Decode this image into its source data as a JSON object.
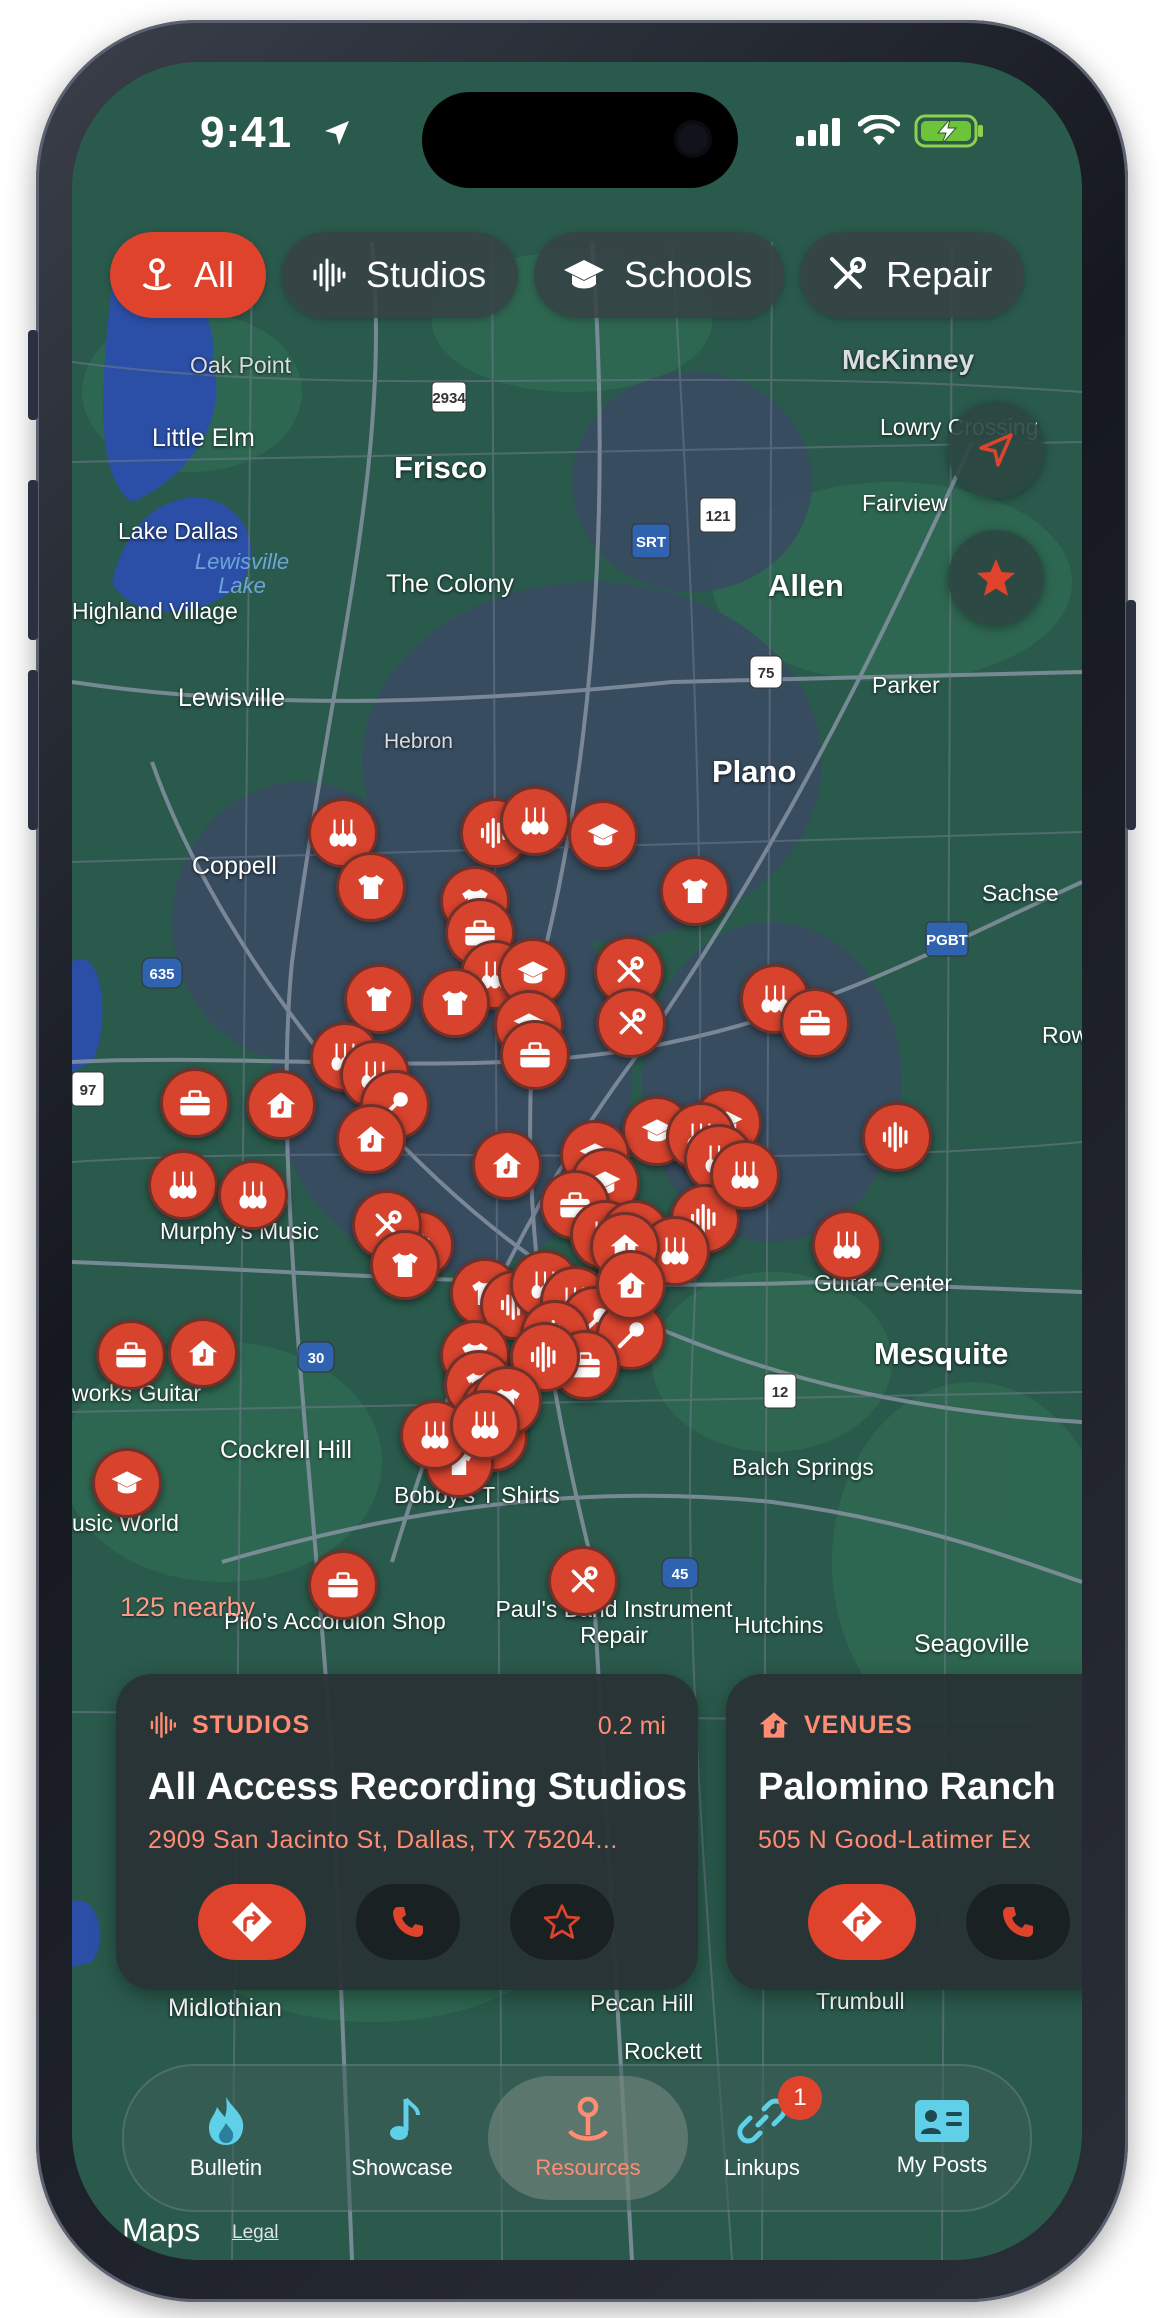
{
  "status_bar": {
    "time": "9:41"
  },
  "filters": [
    {
      "label": "All",
      "icon": "pin-icon",
      "active": true
    },
    {
      "label": "Studios",
      "icon": "waveform-icon",
      "active": false
    },
    {
      "label": "Schools",
      "icon": "graduation-cap-icon",
      "active": false
    },
    {
      "label": "Repair",
      "icon": "tools-icon",
      "active": false
    }
  ],
  "map": {
    "places": [
      "Oak Point",
      "McKinney",
      "Little Elm",
      "Frisco",
      "Lowry Crossing",
      "Fairview",
      "Lake Dallas",
      "The Colony",
      "Allen",
      "Highland Village",
      "Lewisville",
      "Parker",
      "Hebron",
      "Plano",
      "Coppell",
      "Sachse",
      "Row",
      "Murphy's Music",
      "Guitar Center",
      "Mesquite",
      "works Guitar",
      "Cockrell Hill",
      "Balch Springs",
      "usic World",
      "Bobby's T Shirts",
      "Hutchins",
      "Seagoville",
      "Pilo's Accordion Shop",
      "Paul's Band Instrument Repair",
      "Midlothian",
      "Pecan Hill",
      "Trumbull",
      "Rockett"
    ],
    "water": [
      "Lewisville Lake"
    ],
    "shields": [
      "2934",
      "121",
      "SRT",
      "75",
      "PGBT",
      "635",
      "30",
      "12",
      "45",
      "SPUR 97"
    ],
    "nearby": "125 nearby"
  },
  "cards": [
    {
      "category": "STUDIOS",
      "category_icon": "waveform-icon",
      "distance": "0.2 mi",
      "name": "All Access Recording Studios",
      "address": "2909 San Jacinto St, Dallas, TX  75204..."
    },
    {
      "category": "VENUES",
      "category_icon": "venue-house-icon",
      "distance": "",
      "name": "Palomino Ranch",
      "address": "505 N Good-Latimer Ex"
    }
  ],
  "tabs": [
    {
      "label": "Bulletin",
      "icon": "flame-icon",
      "active": false,
      "badge": ""
    },
    {
      "label": "Showcase",
      "icon": "music-note-icon",
      "active": false,
      "badge": ""
    },
    {
      "label": "Resources",
      "icon": "pin-icon",
      "active": true,
      "badge": ""
    },
    {
      "label": "Linkups",
      "icon": "link-icon",
      "active": false,
      "badge": "1"
    },
    {
      "label": "My Posts",
      "icon": "id-card-icon",
      "active": false,
      "badge": ""
    }
  ],
  "attribution": {
    "maps": "Maps",
    "legal": "Legal"
  },
  "colors": {
    "accent": "#e0432b",
    "accent_text": "#ff8c73",
    "map_green": "#26574a"
  }
}
